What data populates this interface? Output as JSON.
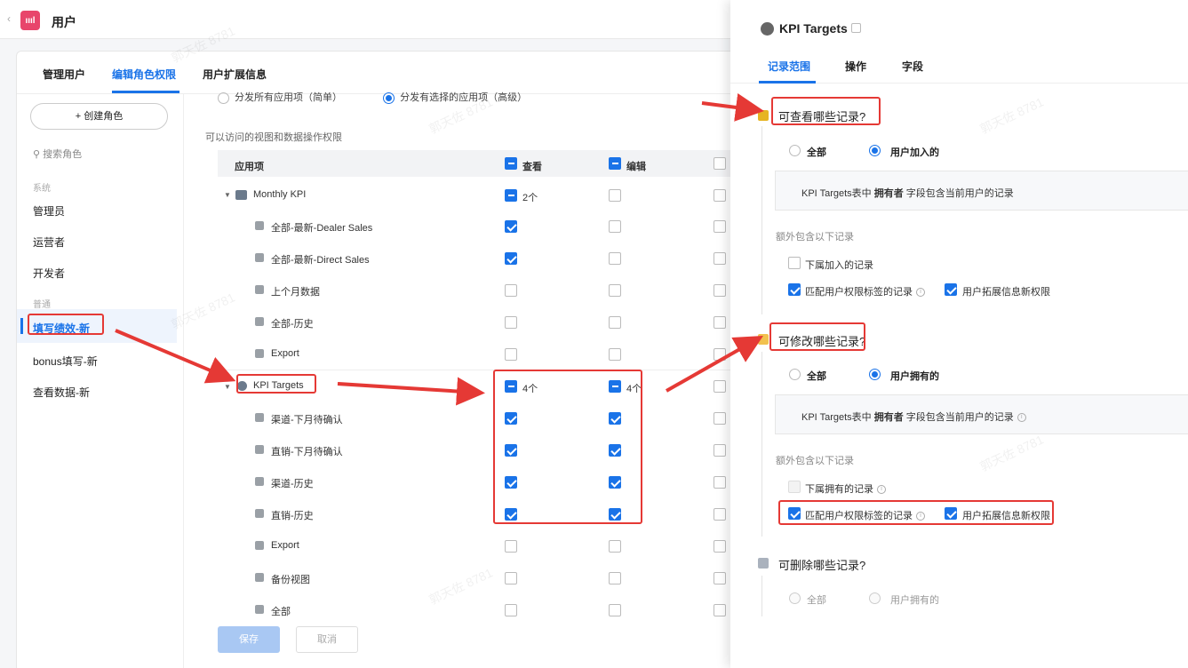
{
  "app": {
    "title": "用户",
    "icon_text": "ıııl"
  },
  "tabs": [
    "管理用户",
    "编辑角色权限",
    "用户扩展信息"
  ],
  "roles": {
    "create_button": "+ 创建角色",
    "search_placeholder": "搜索角色",
    "group_system": "系统",
    "system_roles": [
      "管理员",
      "运营者",
      "开发者"
    ],
    "group_normal": "普通",
    "normal_roles": [
      "填写绩效-新",
      "bonus填写-新",
      "查看数据-新"
    ]
  },
  "permissions": {
    "distribute_all": "分发所有应用项（简单）",
    "distribute_selected": "分发有选择的应用项（高级）",
    "caption": "可以访问的视图和数据操作权限",
    "header": {
      "app_item": "应用项",
      "view": "查看",
      "edit": "编辑"
    },
    "groups": [
      {
        "name": "Monthly KPI",
        "view_count": "2个",
        "edit_count": "",
        "items": [
          {
            "label": "全部-最新-Dealer Sales",
            "view": true,
            "edit": false
          },
          {
            "label": "全部-最新-Direct Sales",
            "view": true,
            "edit": false
          },
          {
            "label": "上个月数据",
            "view": false,
            "edit": false
          },
          {
            "label": "全部-历史",
            "view": false,
            "edit": false
          },
          {
            "label": "Export",
            "view": false,
            "edit": false
          }
        ]
      },
      {
        "name": "KPI Targets",
        "view_count": "4个",
        "edit_count": "4个",
        "items": [
          {
            "label": "渠道-下月待确认",
            "view": true,
            "edit": true
          },
          {
            "label": "直销-下月待确认",
            "view": true,
            "edit": true
          },
          {
            "label": "渠道-历史",
            "view": true,
            "edit": true
          },
          {
            "label": "直销-历史",
            "view": true,
            "edit": true
          },
          {
            "label": "Export",
            "view": false,
            "edit": false
          },
          {
            "label": "备份视图",
            "view": false,
            "edit": false
          },
          {
            "label": "全部",
            "view": false,
            "edit": false
          }
        ]
      }
    ],
    "save": "保存",
    "cancel": "取消"
  },
  "drawer": {
    "title": "KPI Targets",
    "tabs": [
      "记录范围",
      "操作",
      "字段"
    ],
    "view_section": {
      "title": "可查看哪些记录?",
      "opt_all": "全部",
      "opt_user": "用户加入的",
      "info_prefix": "KPI Targets表中",
      "info_bold": "拥有者",
      "info_suffix": "字段包含当前用户的记录",
      "extra_label": "额外包含以下记录",
      "sub_joined": "下属加入的记录",
      "match_tag": "匹配用户权限标签的记录",
      "ext_perm": "用户拓展信息新权限"
    },
    "edit_section": {
      "title": "可修改哪些记录?",
      "opt_all": "全部",
      "opt_user": "用户拥有的",
      "info_prefix": "KPI Targets表中",
      "info_bold": "拥有者",
      "info_suffix": "字段包含当前用户的记录",
      "extra_label": "额外包含以下记录",
      "sub_owned": "下属拥有的记录",
      "match_tag": "匹配用户权限标签的记录",
      "ext_perm": "用户拓展信息新权限"
    },
    "delete_section": {
      "title": "可删除哪些记录?",
      "opt_all": "全部",
      "opt_user": "用户拥有的"
    }
  },
  "watermark": "郭天佐 8781",
  "colors": {
    "accent": "#1a73e8",
    "annotation": "#e53935",
    "app_icon": "#e8456b"
  }
}
